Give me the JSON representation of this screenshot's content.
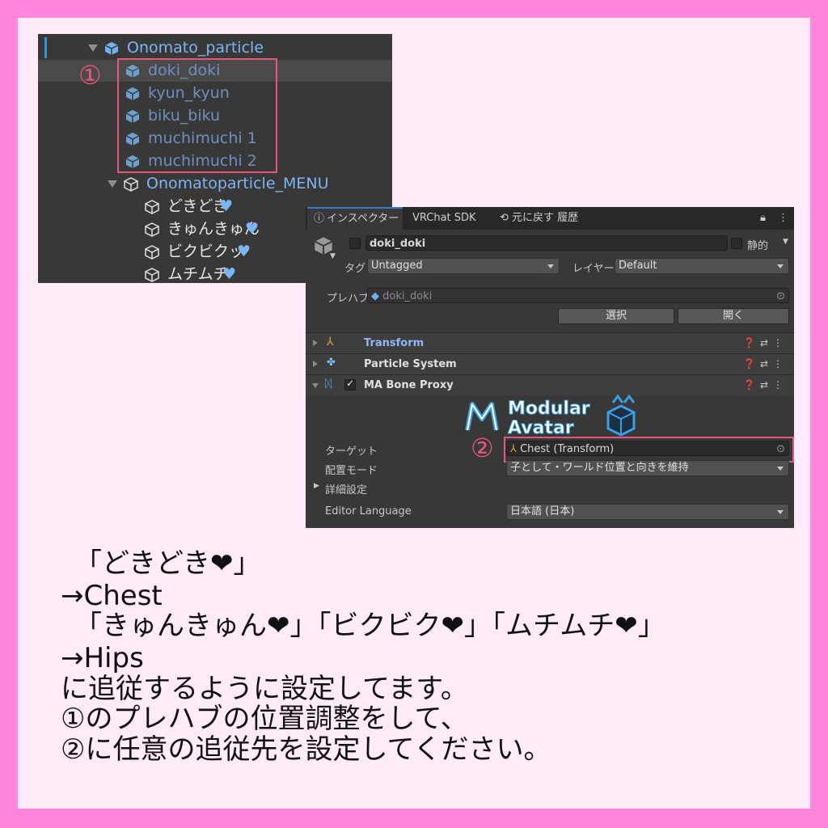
{
  "hierarchy": {
    "root": "Onomato_particle",
    "children": [
      "doki_doki",
      "kyun_kyun",
      "biku_biku",
      "muchimuchi 1",
      "muchimuchi 2"
    ],
    "menu": "Onomatoparticle_MENU",
    "menu_items": [
      "どきどき",
      "きゅんきゅん",
      "ビクビクッ",
      "ムチムチ"
    ],
    "heart": "♥",
    "marker": "①"
  },
  "inspector": {
    "tabs": [
      "インスペクター",
      "VRChat SDK",
      "元に戻す 履歴"
    ],
    "object_name": "doki_doki",
    "static_label": "静的",
    "tag_label": "タグ",
    "tag_value": "Untagged",
    "layer_label": "レイヤー",
    "layer_value": "Default",
    "prefab_label": "プレハブ",
    "prefab_value": "doki_doki",
    "select_button": "選択",
    "open_button": "開く",
    "components": [
      "Transform",
      "Particle System",
      "MA Bone Proxy"
    ],
    "logo_line1": "Modular",
    "logo_line2": "Avatar",
    "target_label": "ターゲット",
    "target_value": "Chest (Transform)",
    "attach_mode_label": "配置モード",
    "attach_mode_value": "子として・ワールド位置と向きを維持",
    "advanced_label": "詳細設定",
    "editor_language_label": "Editor Language",
    "editor_language_value": "日本語 (日本)",
    "marker": "②"
  },
  "notes": [
    "「どきどき❤」",
    "→Chest",
    "「きゅんきゅん❤」「ビクビク❤」「ムチムチ❤」",
    "→Hips",
    "に追従するように設定してます。",
    "①のプレハブの位置調整をして、",
    "②に任意の追従先を設定してください。"
  ],
  "colors": {
    "frame": "#ff86da",
    "card": "#ffeaf8",
    "panel": "#383838",
    "highlight": "#e8557a",
    "accent": "#3e8ed8"
  }
}
